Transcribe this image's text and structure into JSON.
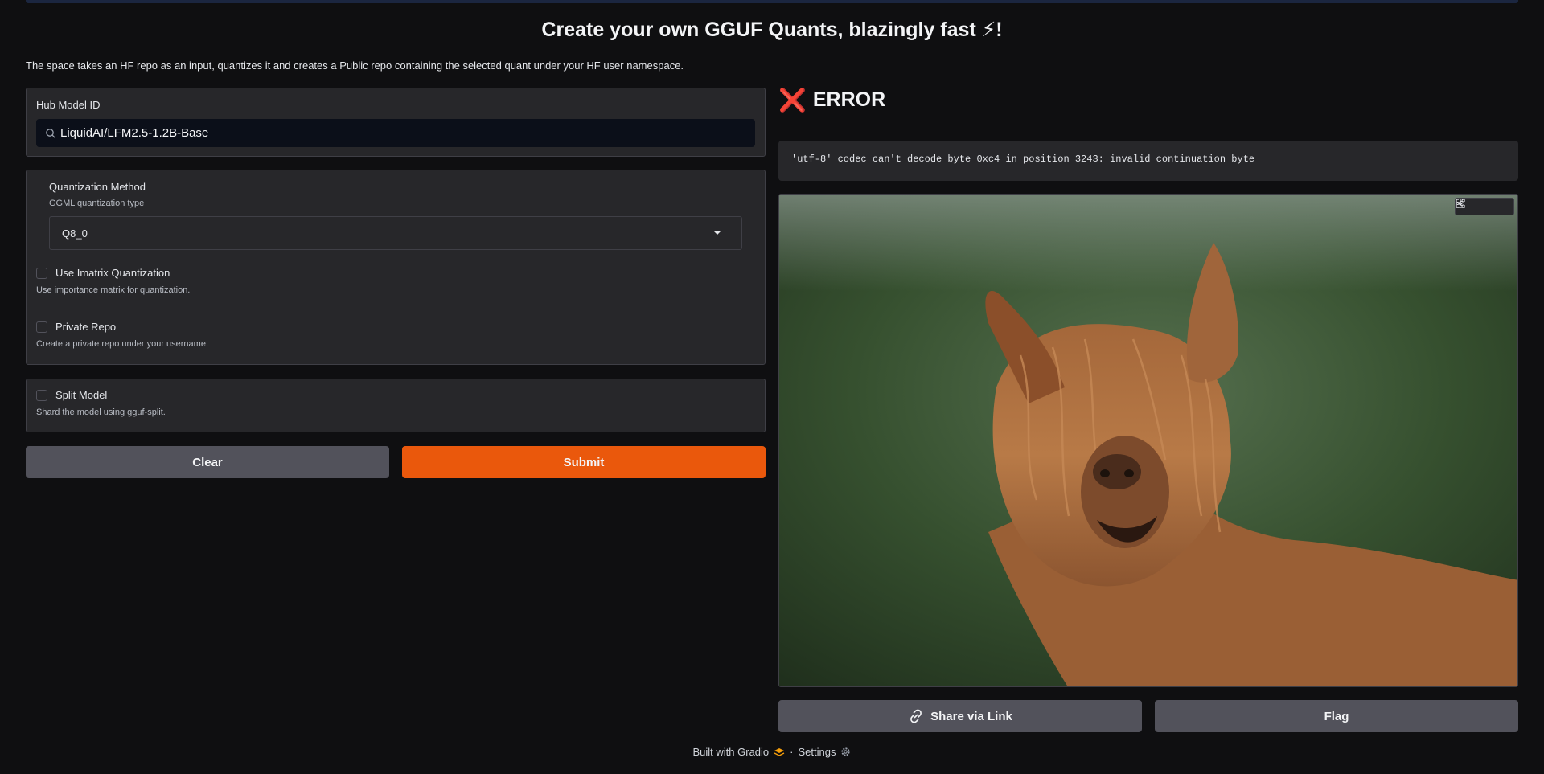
{
  "header": {
    "title": "Create your own GGUF Quants, blazingly fast ⚡!",
    "description": "The space takes an HF repo as an input, quantizes it and creates a Public repo containing the selected quant under your HF user namespace."
  },
  "hub_model": {
    "label": "Hub Model ID",
    "value": "LiquidAI/LFM2.5-1.2B-Base",
    "icon": "search-icon"
  },
  "quantization": {
    "label": "Quantization Method",
    "info": "GGML quantization type",
    "selected": "Q8_0"
  },
  "options": {
    "imatrix": {
      "label": "Use Imatrix Quantization",
      "info": "Use importance matrix for quantization.",
      "checked": false
    },
    "private_repo": {
      "label": "Private Repo",
      "info": "Create a private repo under your username.",
      "checked": false
    },
    "split_model": {
      "label": "Split Model",
      "info": "Shard the model using gguf-split.",
      "checked": false
    }
  },
  "buttons": {
    "clear": "Clear",
    "submit": "Submit",
    "share": "Share via Link",
    "flag": "Flag"
  },
  "output": {
    "error_icon": "❌",
    "error_title": "ERROR",
    "error_message": "'utf-8' codec can't decode byte 0xc4 in position 3243: invalid continuation byte",
    "image_tools": [
      "fullscreen-icon",
      "download-icon",
      "share-icon"
    ]
  },
  "footer": {
    "built_with": "Built with Gradio",
    "separator": "·",
    "settings": "Settings"
  },
  "colors": {
    "background": "#0f0f11",
    "panel": "#27272a",
    "primary": "#ea580c",
    "secondary": "#52525b",
    "error": "#e11d2a"
  }
}
